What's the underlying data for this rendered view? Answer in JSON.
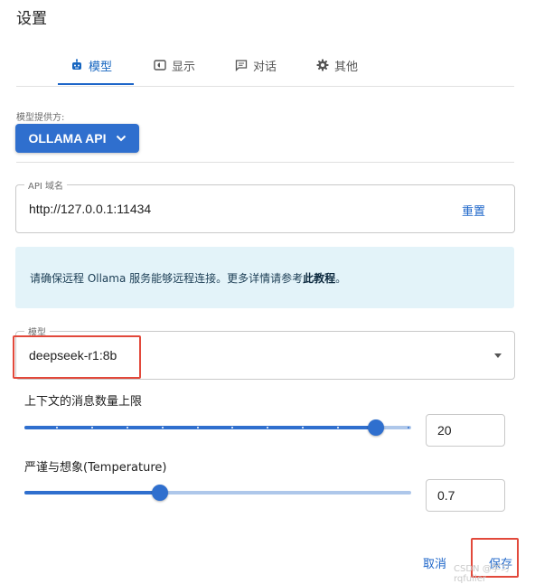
{
  "dialog": {
    "title": "设置"
  },
  "tabs": [
    {
      "label": "模型",
      "icon": "robot-icon",
      "active": true
    },
    {
      "label": "显示",
      "icon": "display-icon",
      "active": false
    },
    {
      "label": "对话",
      "icon": "chat-icon",
      "active": false
    },
    {
      "label": "其他",
      "icon": "gear-icon",
      "active": false
    }
  ],
  "provider": {
    "label": "模型提供方:",
    "value": "OLLAMA API"
  },
  "api_host": {
    "legend": "API 域名",
    "value": "http://127.0.0.1:11434",
    "reset_label": "重置"
  },
  "notice": {
    "text_prefix": "请确保远程 Ollama 服务能够远程连接。更多详情请参考",
    "link": "此教程",
    "text_suffix": "。"
  },
  "model": {
    "legend": "模型",
    "value": "deepseek-r1:8b"
  },
  "context_limit": {
    "label": "上下文的消息数量上限",
    "value": "20",
    "fraction": 0.91
  },
  "temperature": {
    "label": "严谨与想象(Temperature)",
    "value": "0.7",
    "fraction": 0.35
  },
  "footer": {
    "cancel_label": "取消",
    "save_label": "保存"
  },
  "watermark": "CSDN @学习rqfuller",
  "colors": {
    "accent": "#2f6fce",
    "highlight": "#e2493b",
    "notice_bg": "#e3f3f9"
  }
}
